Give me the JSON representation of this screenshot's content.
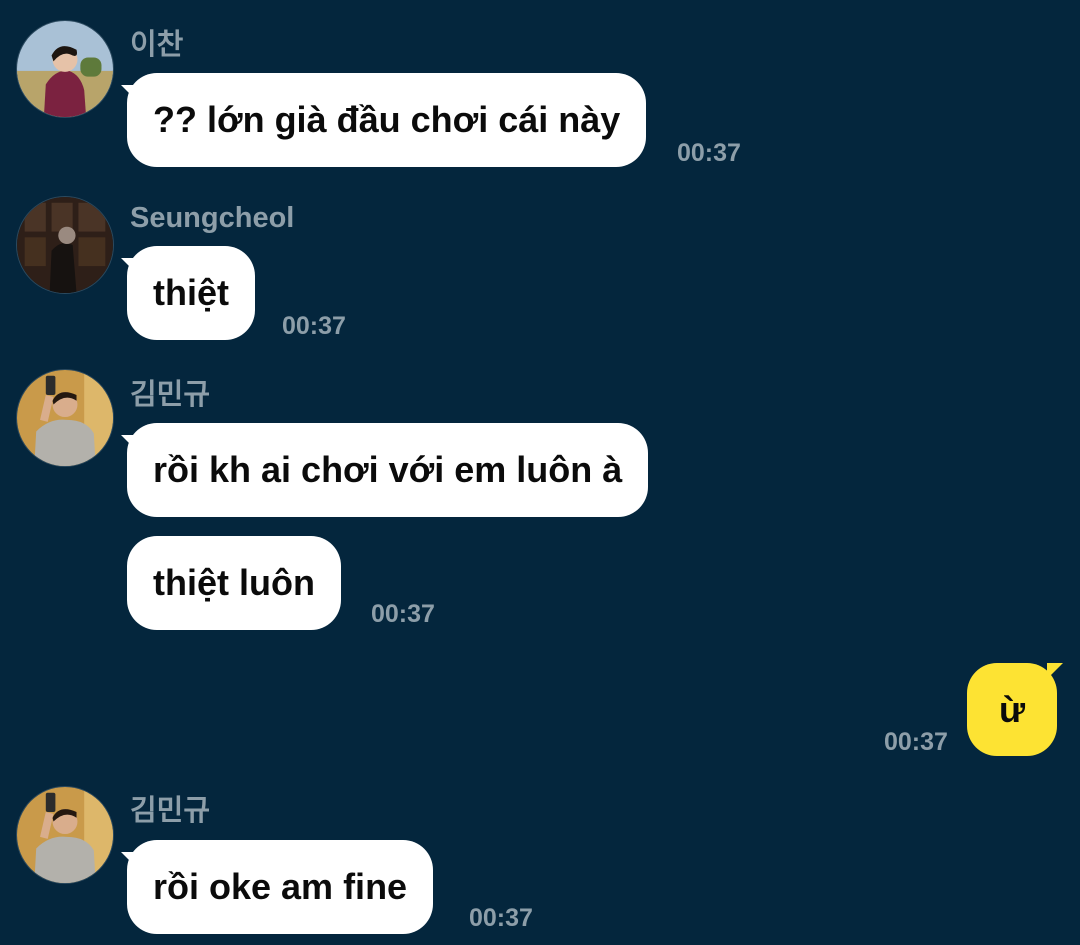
{
  "messages": [
    {
      "sender": "이찬",
      "avatar_icon": "avatar-person-maroon-hoodie-icon",
      "bubbles": [
        "?? lớn già đầu chơi cái này"
      ],
      "time": "00:37"
    },
    {
      "sender": "Seungcheol",
      "avatar_icon": "avatar-person-dark-room-icon",
      "bubbles": [
        "thiệt"
      ],
      "time": "00:37"
    },
    {
      "sender": "김민규",
      "avatar_icon": "avatar-person-mirror-selfie-icon",
      "bubbles": [
        "rồi kh ai chơi với em luôn à",
        "thiệt luôn"
      ],
      "time": "00:37"
    },
    {
      "sender": "me",
      "bubbles": [
        "ừ"
      ],
      "time": "00:37"
    },
    {
      "sender": "김민규",
      "avatar_icon": "avatar-person-mirror-selfie-icon",
      "bubbles": [
        "rồi oke am fine"
      ],
      "time": "00:37"
    }
  ],
  "colors": {
    "background": "#04263d",
    "incoming_bubble": "#ffffff",
    "outgoing_bubble": "#fde333",
    "meta_text": "#8d9ea9"
  }
}
